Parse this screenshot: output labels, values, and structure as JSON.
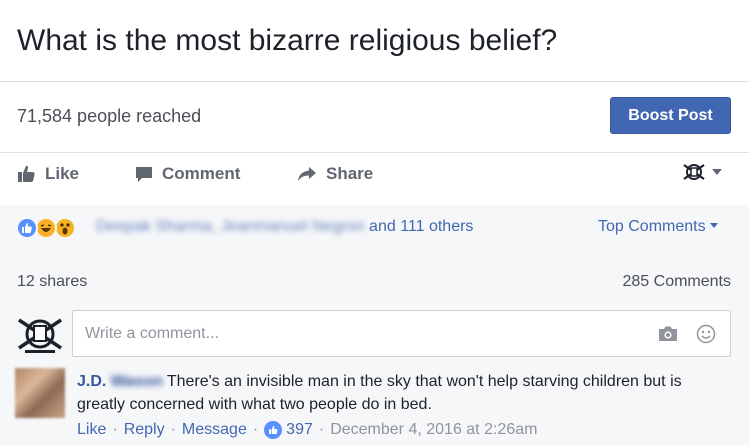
{
  "post": {
    "title": "What is the most bizarre religious belief?"
  },
  "insights": {
    "reach": "71,584 people reached",
    "boost_label": "Boost Post"
  },
  "actions": {
    "like": "Like",
    "comment": "Comment",
    "share": "Share"
  },
  "reactions": {
    "names_blurred": "Deepak Sharma, Jeanmanuel Negron",
    "others": " and 111 others",
    "sort_label": "Top Comments",
    "icons": [
      "like-reaction-icon",
      "haha-reaction-icon",
      "wow-reaction-icon"
    ]
  },
  "counts": {
    "shares": "12 shares",
    "comments": "285 Comments"
  },
  "composer": {
    "placeholder": "Write a comment..."
  },
  "comment": {
    "author": "J.D.",
    "author_blurred": "Wason",
    "text": " There's an invisible man in the sky that won't help starving children but is greatly concerned with what two people do in bed.",
    "like_link": "Like",
    "reply_link": "Reply",
    "message_link": "Message",
    "like_count": "397",
    "timestamp": "December 4, 2016 at 2:26am"
  },
  "colors": {
    "link": "#4267b2",
    "boost_bg": "#4267b2",
    "bar_bg": "#f6f7f9",
    "text_muted": "#616770"
  }
}
